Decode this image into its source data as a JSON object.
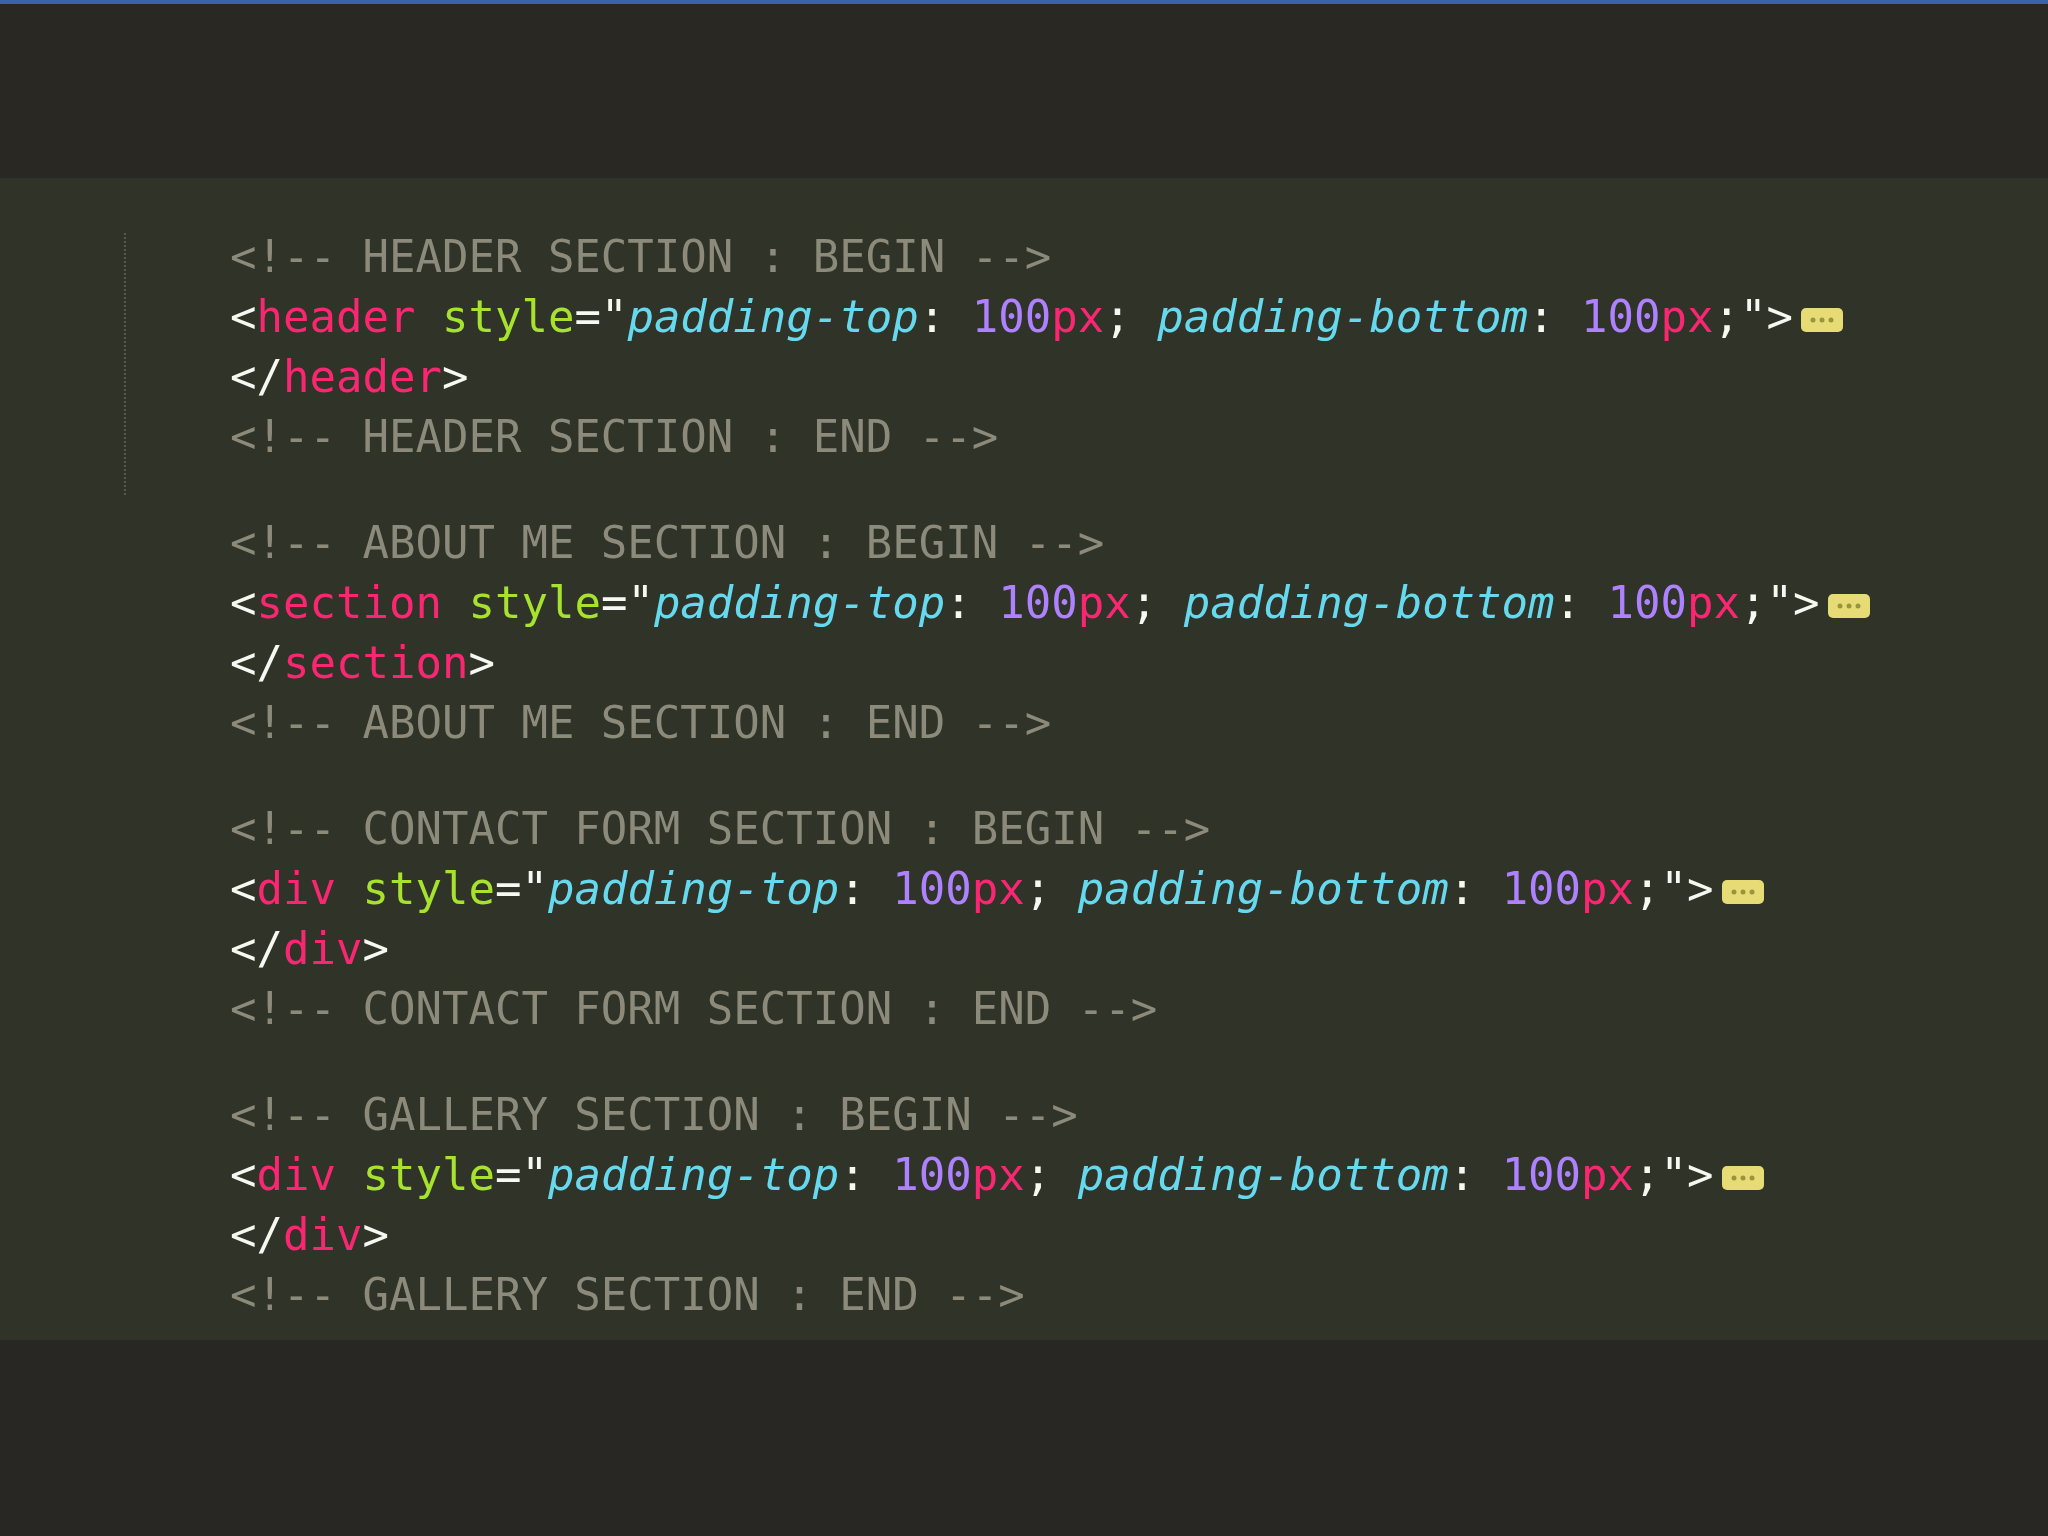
{
  "code_blocks": [
    {
      "indent_guide": true,
      "lines": [
        {
          "folded": false,
          "tokens": [
            {
              "kind": "comment",
              "text": "<!-- HEADER SECTION : BEGIN -->"
            }
          ]
        },
        {
          "folded": true,
          "tokens": [
            {
              "kind": "punct",
              "text": "<"
            },
            {
              "kind": "tag",
              "text": "header"
            },
            {
              "kind": "attr",
              "text": " style"
            },
            {
              "kind": "punct",
              "text": "=\""
            },
            {
              "kind": "string",
              "text": "padding-top"
            },
            {
              "kind": "punct",
              "text": ": "
            },
            {
              "kind": "number",
              "text": "100"
            },
            {
              "kind": "unit",
              "text": "px"
            },
            {
              "kind": "punct",
              "text": "; "
            },
            {
              "kind": "string",
              "text": "padding-bottom"
            },
            {
              "kind": "punct",
              "text": ": "
            },
            {
              "kind": "number",
              "text": "100"
            },
            {
              "kind": "unit",
              "text": "px"
            },
            {
              "kind": "punct",
              "text": ";\">"
            }
          ]
        },
        {
          "folded": false,
          "tokens": [
            {
              "kind": "punct",
              "text": "</"
            },
            {
              "kind": "tag",
              "text": "header"
            },
            {
              "kind": "punct",
              "text": ">"
            }
          ]
        },
        {
          "folded": false,
          "tokens": [
            {
              "kind": "comment",
              "text": "<!-- HEADER SECTION : END -->"
            }
          ]
        }
      ]
    },
    {
      "indent_guide": false,
      "lines": [
        {
          "folded": false,
          "tokens": [
            {
              "kind": "comment",
              "text": "<!-- ABOUT ME SECTION : BEGIN -->"
            }
          ]
        },
        {
          "folded": true,
          "tokens": [
            {
              "kind": "punct",
              "text": "<"
            },
            {
              "kind": "tag",
              "text": "section"
            },
            {
              "kind": "attr",
              "text": " style"
            },
            {
              "kind": "punct",
              "text": "=\""
            },
            {
              "kind": "string",
              "text": "padding-top"
            },
            {
              "kind": "punct",
              "text": ": "
            },
            {
              "kind": "number",
              "text": "100"
            },
            {
              "kind": "unit",
              "text": "px"
            },
            {
              "kind": "punct",
              "text": "; "
            },
            {
              "kind": "string",
              "text": "padding-bottom"
            },
            {
              "kind": "punct",
              "text": ": "
            },
            {
              "kind": "number",
              "text": "100"
            },
            {
              "kind": "unit",
              "text": "px"
            },
            {
              "kind": "punct",
              "text": ";\">"
            }
          ]
        },
        {
          "folded": false,
          "tokens": [
            {
              "kind": "punct",
              "text": "</"
            },
            {
              "kind": "tag",
              "text": "section"
            },
            {
              "kind": "punct",
              "text": ">"
            }
          ]
        },
        {
          "folded": false,
          "tokens": [
            {
              "kind": "comment",
              "text": "<!-- ABOUT ME SECTION : END -->"
            }
          ]
        }
      ]
    },
    {
      "indent_guide": false,
      "lines": [
        {
          "folded": false,
          "tokens": [
            {
              "kind": "comment",
              "text": "<!-- CONTACT FORM SECTION : BEGIN -->"
            }
          ]
        },
        {
          "folded": true,
          "tokens": [
            {
              "kind": "punct",
              "text": "<"
            },
            {
              "kind": "tag",
              "text": "div"
            },
            {
              "kind": "attr",
              "text": " style"
            },
            {
              "kind": "punct",
              "text": "=\""
            },
            {
              "kind": "string",
              "text": "padding-top"
            },
            {
              "kind": "punct",
              "text": ": "
            },
            {
              "kind": "number",
              "text": "100"
            },
            {
              "kind": "unit",
              "text": "px"
            },
            {
              "kind": "punct",
              "text": "; "
            },
            {
              "kind": "string",
              "text": "padding-bottom"
            },
            {
              "kind": "punct",
              "text": ": "
            },
            {
              "kind": "number",
              "text": "100"
            },
            {
              "kind": "unit",
              "text": "px"
            },
            {
              "kind": "punct",
              "text": ";\">"
            }
          ]
        },
        {
          "folded": false,
          "tokens": [
            {
              "kind": "punct",
              "text": "</"
            },
            {
              "kind": "tag",
              "text": "div"
            },
            {
              "kind": "punct",
              "text": ">"
            }
          ]
        },
        {
          "folded": false,
          "tokens": [
            {
              "kind": "comment",
              "text": "<!-- CONTACT FORM SECTION : END -->"
            }
          ]
        }
      ]
    },
    {
      "indent_guide": false,
      "lines": [
        {
          "folded": false,
          "tokens": [
            {
              "kind": "comment",
              "text": "<!-- GALLERY SECTION : BEGIN -->"
            }
          ]
        },
        {
          "folded": true,
          "tokens": [
            {
              "kind": "punct",
              "text": "<"
            },
            {
              "kind": "tag",
              "text": "div"
            },
            {
              "kind": "attr",
              "text": " style"
            },
            {
              "kind": "punct",
              "text": "=\""
            },
            {
              "kind": "string",
              "text": "padding-top"
            },
            {
              "kind": "punct",
              "text": ": "
            },
            {
              "kind": "number",
              "text": "100"
            },
            {
              "kind": "unit",
              "text": "px"
            },
            {
              "kind": "punct",
              "text": "; "
            },
            {
              "kind": "string",
              "text": "padding-bottom"
            },
            {
              "kind": "punct",
              "text": ": "
            },
            {
              "kind": "number",
              "text": "100"
            },
            {
              "kind": "unit",
              "text": "px"
            },
            {
              "kind": "punct",
              "text": ";\">"
            }
          ]
        },
        {
          "folded": false,
          "tokens": [
            {
              "kind": "punct",
              "text": "</"
            },
            {
              "kind": "tag",
              "text": "div"
            },
            {
              "kind": "punct",
              "text": ">"
            }
          ]
        },
        {
          "folded": false,
          "tokens": [
            {
              "kind": "comment",
              "text": "<!-- GALLERY SECTION : END -->"
            }
          ]
        }
      ]
    }
  ]
}
